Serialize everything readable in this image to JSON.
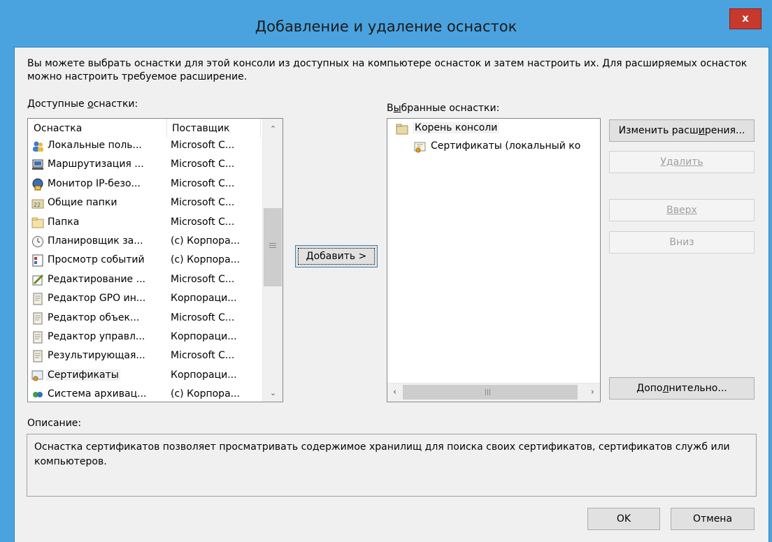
{
  "window": {
    "title": "Добавление и удаление оснасток",
    "close_label": "x"
  },
  "intro_text": "Вы можете выбрать оснастки для этой консоли из доступных на компьютере оснасток и затем настроить их. Для расширяемых оснасток можно настроить требуемое расширение.",
  "available": {
    "label_pre": "Доступные ",
    "label_acc": "о",
    "label_post": "снастки:",
    "col_name": "Оснастка",
    "col_vendor": "Поставщик",
    "items": [
      {
        "name": "Локальные поль...",
        "vendor": "Microsoft C...",
        "icon": "users-icon"
      },
      {
        "name": "Маршрутизация ...",
        "vendor": "Microsoft C...",
        "icon": "routing-icon"
      },
      {
        "name": "Монитор IP-безо...",
        "vendor": "Microsoft C...",
        "icon": "ipsec-monitor-icon"
      },
      {
        "name": "Общие папки",
        "vendor": "Microsoft C...",
        "icon": "shared-folders-icon"
      },
      {
        "name": "Папка",
        "vendor": "Microsoft C...",
        "icon": "folder-icon"
      },
      {
        "name": "Планировщик за...",
        "vendor": "(c) Корпора...",
        "icon": "clock-icon"
      },
      {
        "name": "Просмотр событий",
        "vendor": "(c) Корпора...",
        "icon": "event-viewer-icon"
      },
      {
        "name": "Редактирование ...",
        "vendor": "Microsoft C...",
        "icon": "edit-icon"
      },
      {
        "name": "Редактор GPO ин...",
        "vendor": "Корпораци...",
        "icon": "scroll-icon"
      },
      {
        "name": "Редактор объек...",
        "vendor": "Microsoft C...",
        "icon": "scroll-icon"
      },
      {
        "name": "Редактор управл...",
        "vendor": "Корпораци...",
        "icon": "scroll-icon"
      },
      {
        "name": "Результирующая...",
        "vendor": "Microsoft C...",
        "icon": "scroll-icon"
      },
      {
        "name": "Сертификаты",
        "vendor": "Корпораци...",
        "icon": "certificate-icon"
      },
      {
        "name": "Система архивац...",
        "vendor": "(c) Корпора...",
        "icon": "backup-icon"
      }
    ]
  },
  "add_button": "Добавить >",
  "selected": {
    "label_pre": "В",
    "label_acc": "ы",
    "label_post": "бранные оснастки:",
    "root": "Корень консоли",
    "child": "Сертификаты (локальный ко"
  },
  "buttons": {
    "edit_ext_pre": "Изменить расш",
    "edit_ext_acc": "и",
    "edit_ext_post": "рения...",
    "remove": "Удалить",
    "up": "Вверх",
    "down": "Вниз",
    "advanced_pre": "Допо",
    "advanced_acc": "л",
    "advanced_post": "нительно...",
    "ok": "OK",
    "cancel": "Отмена"
  },
  "description": {
    "label": "Описание:",
    "text": "Оснастка сертификатов позволяет просматривать содержимое хранилищ для поиска своих сертификатов, сертификатов служб или компьютеров."
  },
  "colors": {
    "frame": "#4aa3df",
    "close": "#c7392c",
    "client": "#f0f0f0"
  }
}
